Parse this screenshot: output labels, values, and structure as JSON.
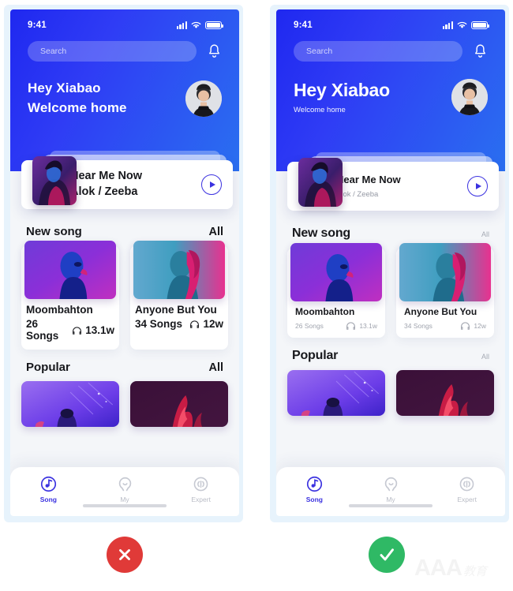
{
  "meta": {
    "watermark_latin": "AAA",
    "watermark_cn": "教育",
    "accent": "#3b32e0",
    "hero_gradient_from": "#1f28f0",
    "hero_gradient_to": "#2a6ff0",
    "bad_color": "#e03a38",
    "good_color": "#2fb965",
    "frame_color": "#e7f3fc",
    "screen_bg": "#f4f6f9"
  },
  "badges": {
    "bad_label": "✕",
    "good_label": "✓"
  },
  "app": {
    "statusbar": {
      "time": "9:41",
      "signal_icon": "signal-bars-icon",
      "wifi_icon": "wifi-icon",
      "battery_icon": "battery-full-icon"
    },
    "search": {
      "placeholder": "Search",
      "icon": "search-input"
    },
    "notification_icon": "bell-icon",
    "greeting": {
      "hi": "Hey Xiabao",
      "sub": "Welcome home",
      "avatar": "avatar"
    },
    "now_playing": {
      "title": "Hear Me Now",
      "artist": "Alok / Zeeba",
      "play_icon": "play-circle-icon",
      "thumb": "album-art"
    },
    "sections": [
      {
        "title": "New song",
        "all_label": "All",
        "cards": [
          {
            "name": "Moombahton",
            "songs": "26 Songs",
            "plays": "13.1w",
            "plays_icon": "headphones-icon"
          },
          {
            "name": "Anyone But You",
            "songs": "34 Songs",
            "plays": "12w",
            "plays_icon": "headphones-icon"
          }
        ]
      },
      {
        "title": "Popular",
        "all_label": "All",
        "cards": []
      }
    ],
    "tabbar": [
      {
        "label": "Song",
        "icon": "music-note-circle-icon",
        "active": true
      },
      {
        "label": "My",
        "icon": "person-circle-icon",
        "active": false
      },
      {
        "label": "Expert",
        "icon": "broadcast-circle-icon",
        "active": false
      }
    ]
  }
}
